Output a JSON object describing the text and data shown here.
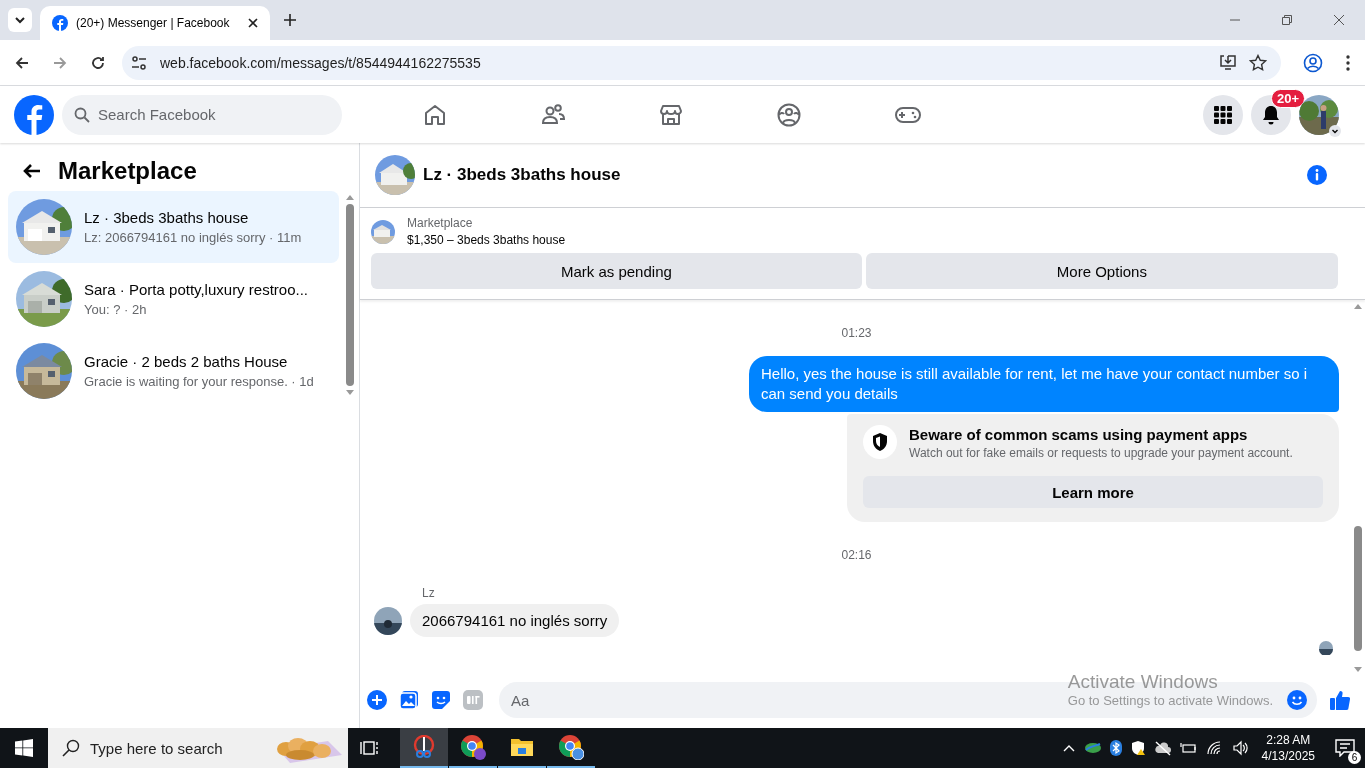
{
  "browser": {
    "tab": {
      "title": "(20+) Messenger | Facebook"
    },
    "address": "web.facebook.com/messages/t/8544944162275535"
  },
  "header": {
    "search": {
      "placeholder": "Search Facebook"
    },
    "notifications_badge": "20+"
  },
  "sidebar": {
    "title": "Marketplace",
    "conversations": [
      {
        "title": "Lz · 3beds 3baths house",
        "preview": "Lz: 2066794161 no inglés sorry · 11m",
        "selected": true
      },
      {
        "title": "Sara · Porta potty,luxury restroo...",
        "preview": "You: ? · 2h",
        "selected": false
      },
      {
        "title": "Gracie · 2 beds 2 baths House",
        "preview": "Gracie is waiting for your response. · 1d",
        "selected": false
      }
    ]
  },
  "chat": {
    "title": "Lz · 3beds 3baths house",
    "listing": {
      "label": "Marketplace",
      "price_title": "$1,350 – 3beds 3baths house"
    },
    "actions": [
      "Mark as pending",
      "More Options"
    ],
    "messages": [
      {
        "kind": "time",
        "text": "01:23"
      },
      {
        "kind": "outgoing",
        "text": "Hello, yes the house is still available for rent, let me have your contact number so i can send you  details"
      },
      {
        "kind": "notice",
        "title": "Beware of common scams using payment apps",
        "text": "Watch out for fake emails or requests to upgrade your payment account.",
        "button": "Learn more"
      },
      {
        "kind": "time",
        "text": "02:16"
      },
      {
        "kind": "sender",
        "text": "Lz"
      },
      {
        "kind": "incoming",
        "text": "2066794161 no inglés sorry"
      }
    ],
    "composer": {
      "placeholder": "Aa"
    }
  },
  "watermark": {
    "title": "Activate Windows",
    "text": "Go to Settings to activate Windows."
  },
  "taskbar": {
    "search": {
      "placeholder": "Type here to search"
    },
    "time": "2:28 AM",
    "date": "4/13/2025",
    "notifications": "6"
  }
}
